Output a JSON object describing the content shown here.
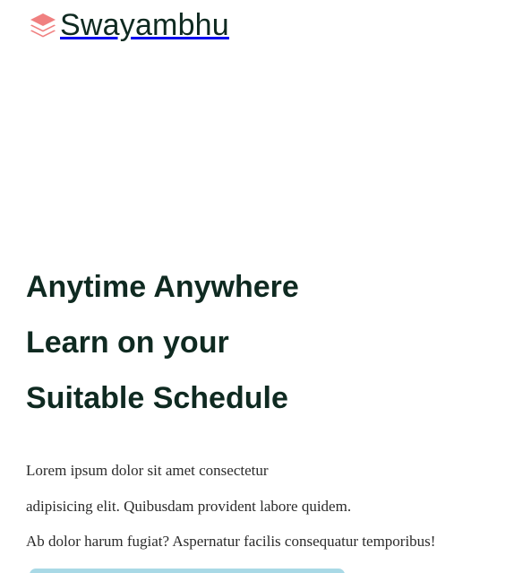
{
  "brand": {
    "name": "Swayambhu",
    "icon": "layers-icon",
    "icon_color": "#f08080"
  },
  "hero": {
    "headline_lines": [
      "Anytime Anywhere",
      "Learn on your",
      "Suitable Schedule"
    ],
    "description_lines": [
      "Lorem ipsum dolor sit amet consectetur",
      "adipisicing elit. Quibusdam provident labore quidem.",
      "Ab dolor harum fugiat? Aspernatur facilis consequatur temporibus!"
    ]
  },
  "colors": {
    "text_dark": "#0f2a21",
    "accent": "#f08080",
    "cta_partial": "#a9d9e6"
  }
}
